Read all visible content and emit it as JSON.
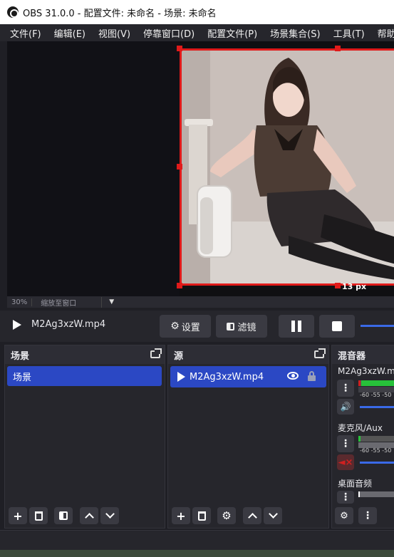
{
  "window": {
    "title": "OBS 31.0.0 - 配置文件: 未命名 - 场景: 未命名"
  },
  "menu": [
    "文件(F)",
    "编辑(E)",
    "视图(V)",
    "停靠窗口(D)",
    "配置文件(P)",
    "场景集合(S)",
    "工具(T)",
    "帮助(H)"
  ],
  "preview": {
    "zoom": "30%",
    "fit_label": "缩放至窗口",
    "size_readout": "13 px"
  },
  "media": {
    "file": "M2Ag3xzW.mp4",
    "settings_label": "设置",
    "filters_label": "滤镜"
  },
  "scenes": {
    "title": "场景",
    "items": [
      "场景"
    ]
  },
  "sources": {
    "title": "源",
    "items": [
      "M2Ag3xzW.mp4"
    ]
  },
  "mixer": {
    "title": "混音器",
    "channels": [
      {
        "name": "M2Ag3xzW.m",
        "ticks": "-60 -55 -50"
      },
      {
        "name": "麦克风/Aux",
        "ticks": "-60 -55 -50"
      },
      {
        "name": "桌面音频",
        "ticks": ""
      }
    ]
  },
  "colors": {
    "accent": "#2b48c4",
    "selection_border": "#e01a1a",
    "meter_green": "#27c23a",
    "mute_red": "#d02020"
  }
}
